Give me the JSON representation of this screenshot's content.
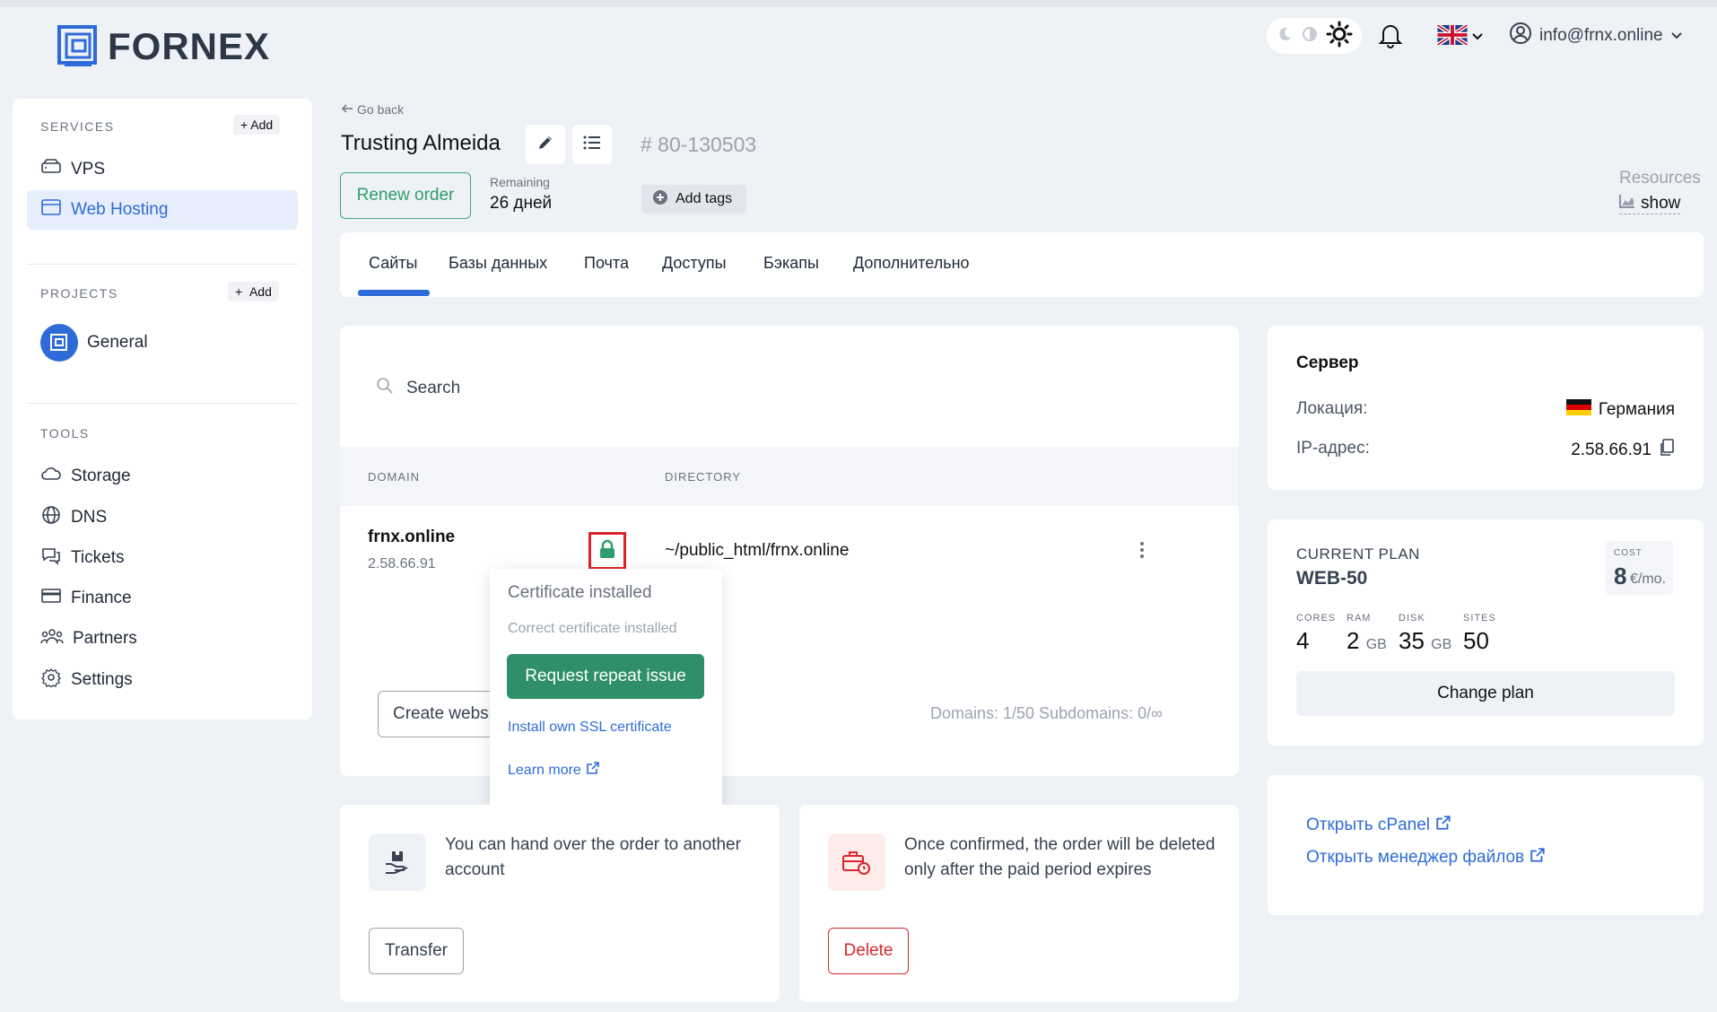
{
  "header": {
    "logo_text": "FORNEX",
    "user_email": "info@frnx.online"
  },
  "sidebar": {
    "services_label": "SERVICES",
    "services_add": "+ Add",
    "services": [
      {
        "label": "VPS",
        "icon": "server-icon"
      },
      {
        "label": "Web Hosting",
        "icon": "browser-icon",
        "active": true
      }
    ],
    "projects_label": "PROJECTS",
    "projects_add": "Add",
    "projects": [
      {
        "label": "General",
        "icon": "fornex-avatar-icon"
      }
    ],
    "tools_label": "TOOLS",
    "tools": [
      {
        "label": "Storage",
        "icon": "cloud-icon"
      },
      {
        "label": "DNS",
        "icon": "globe-icon"
      },
      {
        "label": "Tickets",
        "icon": "chat-icon"
      },
      {
        "label": "Finance",
        "icon": "card-icon"
      },
      {
        "label": "Partners",
        "icon": "users-icon"
      },
      {
        "label": "Settings",
        "icon": "gear-icon"
      }
    ]
  },
  "order": {
    "go_back": "Go back",
    "title": "Trusting Almeida",
    "id": "# 80-130503",
    "renew_label": "Renew order",
    "remaining_label": "Remaining",
    "remaining_value": "26 дней",
    "add_tags": "Add tags",
    "resources_label": "Resources",
    "resources_show": "show"
  },
  "tabs": [
    "Сайты",
    "Базы данных",
    "Почта",
    "Доступы",
    "Бэкапы",
    "Дополнительно"
  ],
  "sites": {
    "search_placeholder": "Search",
    "col_domain": "DOMAIN",
    "col_directory": "DIRECTORY",
    "rows": [
      {
        "domain": "frnx.online",
        "ip": "2.58.66.91",
        "directory": "~/public_html/frnx.online"
      }
    ],
    "create_label": "Create website",
    "counts": "Domains: 1/50   Subdomains: 0/∞"
  },
  "ssl_popup": {
    "title": "Certificate installed",
    "subtitle": "Correct certificate installed",
    "button": "Request repeat issue",
    "install_link": "Install own SSL certificate",
    "learn_more": "Learn more"
  },
  "transfer": {
    "text": "You can hand over the order to another account",
    "button": "Transfer"
  },
  "delete": {
    "text": "Once confirmed, the order will be deleted only after the paid period expires",
    "button": "Delete"
  },
  "server": {
    "title": "Сервер",
    "location_label": "Локация:",
    "location_value": "Германия",
    "ip_label": "IP-адрес:",
    "ip_value": "2.58.66.91"
  },
  "plan": {
    "label": "CURRENT PLAN",
    "name": "WEB-50",
    "cost_label": "COST",
    "cost_value": "8",
    "cost_unit": "€/mo.",
    "specs": [
      {
        "label": "CORES",
        "value": "4",
        "unit": ""
      },
      {
        "label": "RAM",
        "value": "2",
        "unit": "GB"
      },
      {
        "label": "DISK",
        "value": "35",
        "unit": "GB"
      },
      {
        "label": "SITES",
        "value": "50",
        "unit": ""
      }
    ],
    "change_label": "Change plan"
  },
  "links": {
    "cpanel": "Открыть cPanel",
    "filemanager": "Открыть менеджер файлов"
  },
  "colors": {
    "accent": "#2f6bd8",
    "success": "#2f8f68",
    "danger": "#d9262b"
  }
}
